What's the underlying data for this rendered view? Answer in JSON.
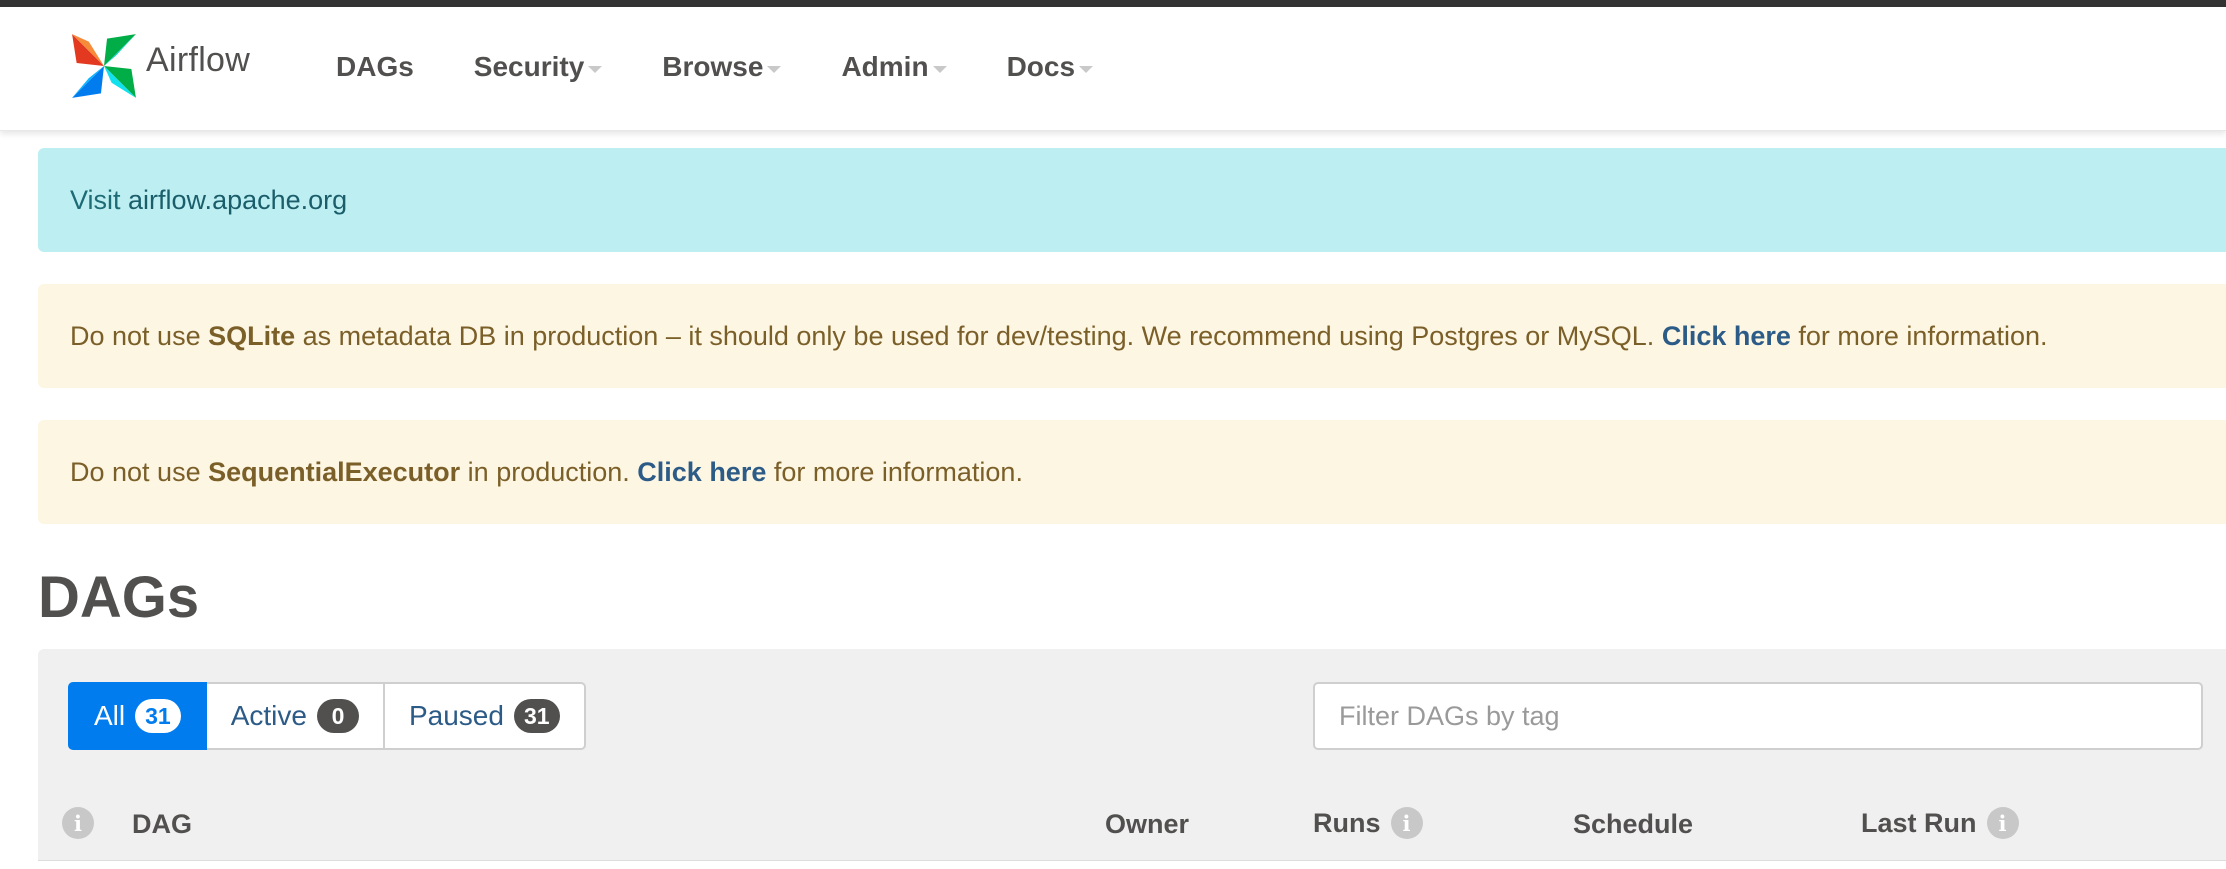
{
  "brand": {
    "name": "Airflow"
  },
  "nav": {
    "items": [
      {
        "label": "DAGs",
        "dropdown": false
      },
      {
        "label": "Security",
        "dropdown": true
      },
      {
        "label": "Browse",
        "dropdown": true
      },
      {
        "label": "Admin",
        "dropdown": true
      },
      {
        "label": "Docs",
        "dropdown": true
      }
    ]
  },
  "alerts": {
    "info": {
      "prefix": "Visit ",
      "link": "airflow.apache.org"
    },
    "sqlite": {
      "t1": "Do not use ",
      "b1": "SQLite",
      "t2": " as metadata DB in production – it should only be used for dev/testing. We recommend using Postgres or MySQL. ",
      "link": "Click here",
      "t3": " for more information."
    },
    "executor": {
      "t1": "Do not use ",
      "b1": "SequentialExecutor",
      "t2": " in production. ",
      "link": "Click here",
      "t3": " for more information."
    }
  },
  "page": {
    "title": "DAGs"
  },
  "filters": {
    "all": {
      "label": "All",
      "count": "31"
    },
    "active": {
      "label": "Active",
      "count": "0"
    },
    "paused": {
      "label": "Paused",
      "count": "31"
    }
  },
  "tag_filter": {
    "placeholder": "Filter DAGs by tag",
    "value": ""
  },
  "table": {
    "columns": {
      "info": "i",
      "dag": "DAG",
      "owner": "Owner",
      "runs": "Runs",
      "schedule": "Schedule",
      "last_run": "Last Run"
    }
  },
  "colors": {
    "accent": "#017cee",
    "info_bg": "#bdeff2",
    "warn_bg": "#fdf6e3",
    "panel_bg": "#f0f0f0"
  }
}
